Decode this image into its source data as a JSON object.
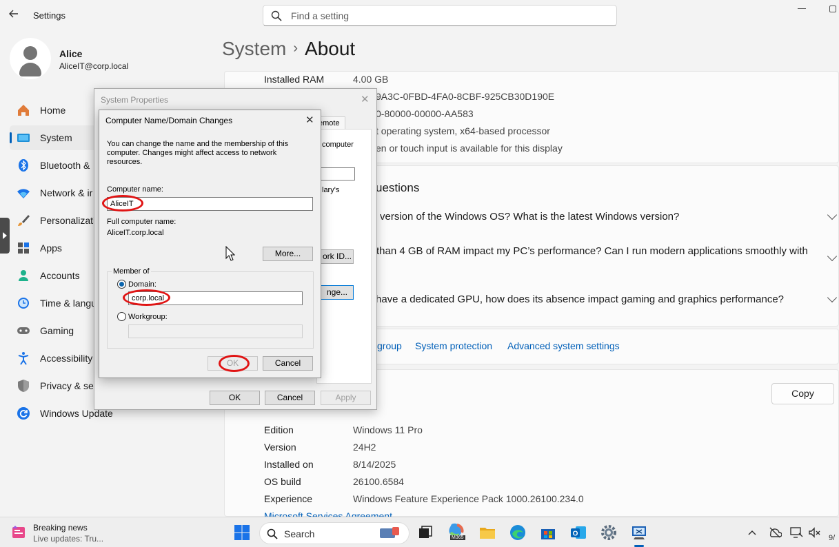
{
  "window": {
    "title": "Settings"
  },
  "search": {
    "placeholder": "Find a setting"
  },
  "profile": {
    "name": "Alice",
    "email": "AliceIT@corp.local"
  },
  "sidebar": {
    "items": [
      {
        "label": "Home",
        "icon": "home-icon"
      },
      {
        "label": "System",
        "icon": "system-icon",
        "selected": true
      },
      {
        "label": "Bluetooth &",
        "icon": "bluetooth-icon"
      },
      {
        "label": "Network & ir",
        "icon": "wifi-icon"
      },
      {
        "label": "Personalizati",
        "icon": "brush-icon"
      },
      {
        "label": "Apps",
        "icon": "apps-icon"
      },
      {
        "label": "Accounts",
        "icon": "accounts-icon"
      },
      {
        "label": "Time & langu",
        "icon": "clock-icon"
      },
      {
        "label": "Gaming",
        "icon": "gamepad-icon"
      },
      {
        "label": "Accessibility",
        "icon": "accessibility-icon"
      },
      {
        "label": "Privacy & sec",
        "icon": "shield-icon"
      },
      {
        "label": "Windows Update",
        "icon": "update-icon"
      }
    ]
  },
  "breadcrumb": {
    "parent": "System",
    "separator": "›",
    "current": "About"
  },
  "device_specs": {
    "installed_ram_label": "Installed RAM",
    "installed_ram_value": "4.00 GB",
    "device_id_fragment": "9A3C-0FBD-4FA0-8CBF-925CB30D190E",
    "product_id_fragment": "0-80000-00000-AA583",
    "system_type_fragment": "t operating system, x64-based processor",
    "pen_touch_fragment": "en or touch input is available for this display"
  },
  "faq": {
    "heading_fragment": "uestions",
    "q1": "version of the Windows OS? What is the latest Windows version?",
    "q2": "than 4 GB of RAM impact my PC’s performance? Can I run modern applications smoothly with",
    "q3": "have a dedicated GPU, how does its absence impact gaming and graphics performance?"
  },
  "related_links": {
    "workgroup_fragment": "group",
    "system_protection": "System protection",
    "advanced_settings": "Advanced system settings"
  },
  "windows_specs": {
    "copy_label": "Copy",
    "rows": [
      {
        "label": "Edition",
        "value": "Windows 11 Pro"
      },
      {
        "label": "Version",
        "value": "24H2"
      },
      {
        "label": "Installed on",
        "value": "8/14/2025"
      },
      {
        "label": "OS build",
        "value": "26100.6584"
      },
      {
        "label": "Experience",
        "value": "Windows Feature Experience Pack 1000.26100.234.0"
      }
    ],
    "msa_link": "Microsoft Services Agreement"
  },
  "system_properties": {
    "title": "System Properties",
    "tab_fragment": "emote",
    "text_fragment_1": "computer",
    "text_fragment_2": "lary's",
    "network_id_fragment": "ork ID...",
    "change_fragment": "nge...",
    "ok": "OK",
    "cancel": "Cancel",
    "apply": "Apply"
  },
  "name_dialog": {
    "title": "Computer Name/Domain Changes",
    "description": "You can change the name and the membership of this computer. Changes might affect access to network resources.",
    "computer_name_label": "Computer name:",
    "computer_name_value": "AliceIT",
    "full_name_label": "Full computer name:",
    "full_name_value": "AliceIT.corp.local",
    "more_button": "More...",
    "member_of_label": "Member of",
    "domain_label": "Domain:",
    "domain_value": "corp.local",
    "workgroup_label": "Workgroup:",
    "workgroup_value": "",
    "ok": "OK",
    "cancel": "Cancel"
  },
  "taskbar": {
    "news_title": "Breaking news",
    "news_sub": "Live updates: Tru...",
    "search_label": "Search",
    "m365_badge": "M365",
    "clock_fragment": "9/"
  },
  "colors": {
    "accent": "#005fb8",
    "annotation": "#e01414",
    "link": "#005fb8"
  }
}
